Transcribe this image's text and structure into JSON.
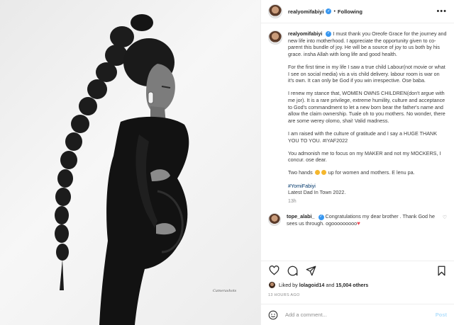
{
  "photo": {
    "credit": "Camerashots",
    "alt_subject": "black-and-white maternity portrait"
  },
  "header": {
    "username": "realyomifabiyi",
    "separator": "•",
    "follow_status": "Following",
    "more_icon": "more-horizontal-icon"
  },
  "caption": {
    "username": "realyomifabiyi",
    "paragraphs": [
      "I must thank you Oreofe Grace for the journey and new life into motherhood. I appreciate the opportunity given to co-parent this bundle of joy. He will be a source of joy to us both by his grace. insha Allah with long life and good health.",
      "For the first time in my life I saw a true child Labour(not movie or what I see on social media) vis a vis child delivery. labour room is war on it's own. It can only be God if you win irrespective. Ose baba.",
      "I renew my stance that, WOMEN OWNS CHILDREN(don't argue with me jor). It is a rare privilege, extreme humility, culture and acceptance to God's commandment to let a new born bear the father's name and allow the claim ownership. Tuale oh to you mothers. No wonder, there are some werey olomo, shai! Valid madness.",
      "I am raised with the culture of gratitude and I say a HUGE THANK YOU TO YOU. #IYAF2022",
      "You admonish me to focus on my MAKER and not my MOCKERS, I concur. ose dear."
    ],
    "two_hands_before": "Two hands",
    "two_hands_after": "up for women and mothers. E lenu pa.",
    "hashtag": "#YomiFabiyi",
    "last_line": "Latest Dad In Town 2022.",
    "time_ago": "13h"
  },
  "comment": {
    "username": "tope_alabi_",
    "text": "Congratulations my dear brother . Thank God he sees us through. ogooooooooo"
  },
  "actions": {
    "like_icon": "heart-icon",
    "comment_icon": "comment-icon",
    "share_icon": "paper-plane-icon",
    "save_icon": "bookmark-icon"
  },
  "likes": {
    "prefix": "Liked by",
    "user": "lolagoid14",
    "joiner": "and",
    "count": "15,004 others"
  },
  "posted_time": "13 HOURS AGO",
  "add_comment": {
    "placeholder": "Add a comment...",
    "post_label": "Post"
  }
}
